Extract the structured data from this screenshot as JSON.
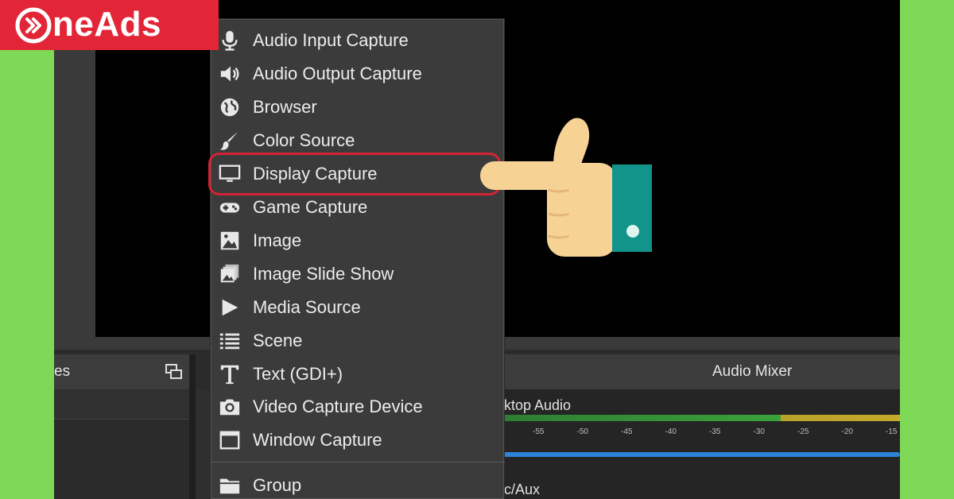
{
  "brand": {
    "logo_text": "neAds",
    "logo_color": "#e22637"
  },
  "colors": {
    "background": "#7ed957",
    "menu_bg": "#3b3b3b",
    "highlight": "#d42434",
    "cuff": "#13948a"
  },
  "docks": {
    "sources_title_fragment": "es",
    "mixer_title": "Audio Mixer"
  },
  "mixer": {
    "channel_1": "ktop Audio",
    "channel_2": "c/Aux",
    "ticks": [
      "-55",
      "-50",
      "-45",
      "-40",
      "-35",
      "-30",
      "-25",
      "-20",
      "-15"
    ]
  },
  "menu": {
    "items": [
      {
        "label": "Audio Input Capture",
        "icon": "microphone-icon"
      },
      {
        "label": "Audio Output Capture",
        "icon": "speaker-icon"
      },
      {
        "label": "Browser",
        "icon": "globe-icon"
      },
      {
        "label": "Color Source",
        "icon": "brush-icon"
      },
      {
        "label": "Display Capture",
        "icon": "monitor-icon"
      },
      {
        "label": "Game Capture",
        "icon": "gamepad-icon"
      },
      {
        "label": "Image",
        "icon": "image-icon"
      },
      {
        "label": "Image Slide Show",
        "icon": "slideshow-icon"
      },
      {
        "label": "Media Source",
        "icon": "play-icon"
      },
      {
        "label": "Scene",
        "icon": "list-icon"
      },
      {
        "label": "Text (GDI+)",
        "icon": "text-icon"
      },
      {
        "label": "Video Capture Device",
        "icon": "camera-icon"
      },
      {
        "label": "Window Capture",
        "icon": "window-icon"
      },
      {
        "label": "Group",
        "icon": "folder-icon"
      }
    ],
    "highlighted_item": "Display Capture"
  }
}
